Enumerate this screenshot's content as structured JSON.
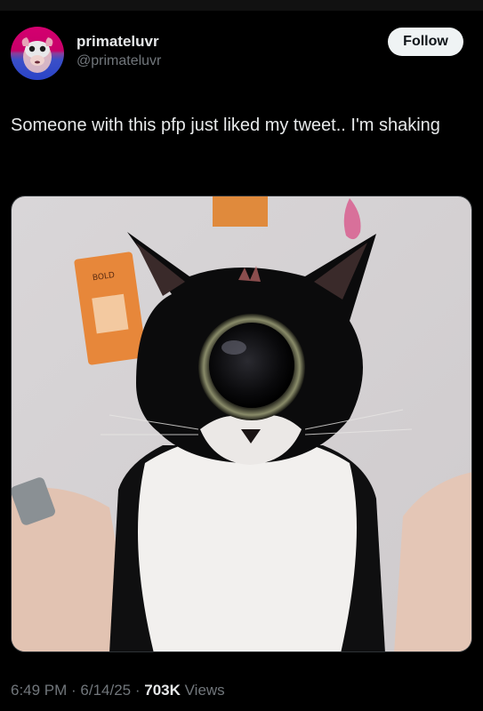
{
  "author": {
    "display_name": "primateluvr",
    "handle": "@primateluvr",
    "avatar_icon": "monkey-avatar-icon"
  },
  "follow_button": {
    "label": "Follow"
  },
  "tweet": {
    "text": "Someone with this pfp just liked my tweet.. I'm shaking"
  },
  "media": {
    "sign_text": "BOLD"
  },
  "meta": {
    "time": "6:49 PM",
    "sep1": " · ",
    "date": "6/14/25",
    "sep2": " · ",
    "views_count": "703K",
    "views_label": " Views"
  },
  "colors": {
    "background": "#000000",
    "text_primary": "#e7e9ea",
    "text_secondary": "#71767b",
    "button_bg": "#eff3f4"
  }
}
